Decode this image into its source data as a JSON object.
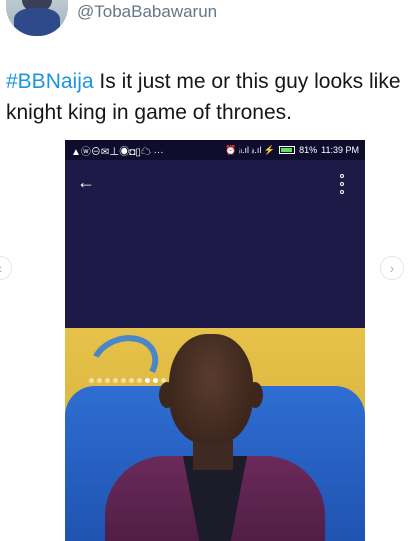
{
  "tweet": {
    "handle": "@TobaBabawarun",
    "hashtag": "#BBNaija",
    "text": " Is it just me or this guy looks like knight king in game of thrones."
  },
  "phone_screenshot": {
    "status_left_icons": "▲ⓦ⊖✉⊥◉◘▯☁ ···",
    "status_right": {
      "signal": "⏰ ᵢₗ.ıl ᵢₗ.ıl ⚡",
      "battery_percent": "81%",
      "time": "11:39 PM"
    },
    "back_icon": "back-arrow-icon",
    "menu_icon": "more-vertical-icon"
  },
  "carousel": {
    "total_dots": 10,
    "active_dots": [
      7,
      8
    ]
  },
  "colors": {
    "hashtag": "#1b95e0",
    "app_bar": "#1d1a48",
    "handle": "#657786"
  }
}
